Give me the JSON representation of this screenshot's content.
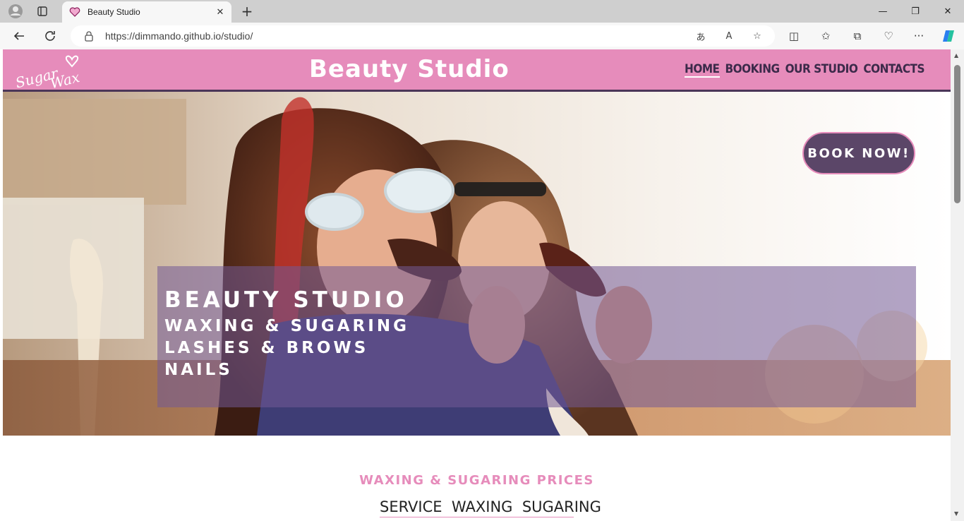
{
  "browser": {
    "tab_title": "Beauty Studio",
    "url": "https://dimmando.github.io/studio/"
  },
  "site": {
    "logo_text": "Sugar Wax",
    "title": "Beauty Studio",
    "nav": [
      {
        "label": "HOME",
        "active": true
      },
      {
        "label": "BOOKING",
        "active": false
      },
      {
        "label": "OUR STUDIO",
        "active": false
      },
      {
        "label": "CONTACTS",
        "active": false
      }
    ]
  },
  "hero": {
    "book_button": "BOOK NOW!",
    "line1": "BEAUTY STUDIO",
    "line2": "WAXING & SUGARING",
    "line3": "LASHES & BROWS",
    "line4": "NAILS"
  },
  "prices": {
    "heading": "WAXING & SUGARING PRICES",
    "table_headers": [
      "SERVICE",
      "WAXING",
      "SUGARING"
    ]
  },
  "colors": {
    "brand_pink": "#e68cbb",
    "brand_purple": "#5b4668"
  }
}
